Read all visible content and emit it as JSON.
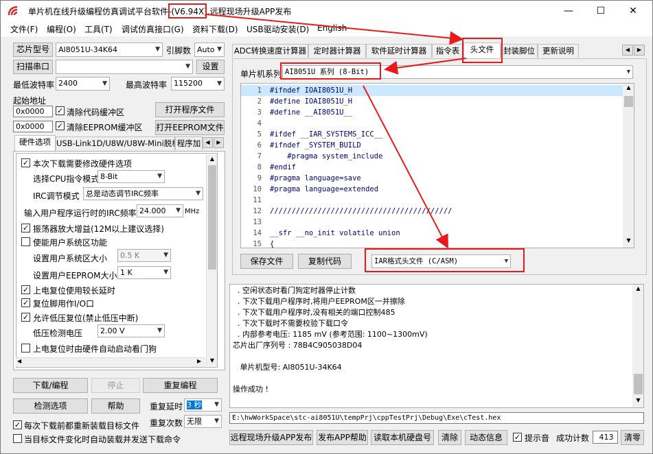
{
  "window": {
    "title_prefix": "单片机在线升级编程仿真调试平台软件-",
    "version": "(V6.94X),",
    "title_suffix": "远程现场升级APP发布",
    "minimize": "—",
    "maximize": "☐",
    "close": "✕"
  },
  "menu": [
    "文件(F)",
    "编程(O)",
    "工具(T)",
    "调试仿真接口(G)",
    "资料下载(D)",
    "USB驱动安装(D)",
    "English"
  ],
  "left": {
    "chip_label": "芯片型号",
    "chip_value": "AI8051U-34K64",
    "pin_label": "引脚数",
    "pin_value": "Auto",
    "scan_button": "扫描串口",
    "port_value": "",
    "settings_button": "设置",
    "min_baud_label": "最低波特率",
    "min_baud_value": "2400",
    "max_baud_label": "最高波特率",
    "max_baud_value": "115200",
    "start_addr_label": "起始地址",
    "addr1": "0x0000",
    "clear_code_label": "清除代码缓冲区",
    "open_program_button": "打开程序文件",
    "addr2": "0x0000",
    "clear_eeprom_label": "清除EEPROM缓冲区",
    "open_eeprom_button": "打开EEPROM文件",
    "tabs": [
      "硬件选项",
      "USB-Link1D/U8W/U8W-Mini脱机",
      "程序加"
    ],
    "hw": {
      "opt_redownload": "本次下载需要修改硬件选项",
      "cpu_mode_label": "选择CPU指令模式",
      "cpu_mode_value": "8-Bit",
      "irc_mode_label": "IRC调节模式",
      "irc_mode_value": "总是动态调节IRC频率",
      "irc_freq_label": "输入用户程序运行时的IRC频率",
      "irc_freq_value": "24.000",
      "irc_freq_unit": "MHz",
      "osc_gain": "振荡器放大增益(12M以上建议选择)",
      "user_sys": "使能用户系统区功能",
      "sys_size_label": "设置用户系统区大小",
      "sys_size_value": "0.5 K",
      "eeprom_size_label": "设置用户EEPROM大小",
      "eeprom_size_value": "1   K",
      "long_reset": "上电复位使用较长延时",
      "reset_io": "复位脚用作I/O口",
      "low_volt_reset": "允许低压复位(禁止低压中断)",
      "low_volt_label": "低压检测电压",
      "low_volt_value": "2.00 V",
      "watchdog": "上电复位时由硬件自动启动看门狗"
    },
    "download_button": "下载/编程",
    "stop_button": "停止",
    "repeat_button": "重复编程",
    "detect_button": "检测选项",
    "help_button": "帮助",
    "repeat_delay_label": "重复延时",
    "repeat_delay_value": "3 秒",
    "repeat_count_label": "重复次数",
    "repeat_count_value": "无限",
    "reload_label": "每次下载前都重新装载目标文件",
    "auto_send_label": "当目标文件变化时自动装载并发送下载命令"
  },
  "right": {
    "tabs": [
      "ADC转换速度计算器",
      "定时器计算器",
      "软件延时计算器",
      "指令表",
      "头文件",
      "封装脚位",
      "更新说明"
    ],
    "series_label": "单片机系列",
    "series_value": "AI8051U 系列 (8-Bit)",
    "code_lines": [
      {
        "n": "1",
        "t": "#ifndef IOAI8051U_H"
      },
      {
        "n": "2",
        "t": "#define IOAI8051U_H"
      },
      {
        "n": "3",
        "t": "#define __AI8051U__"
      },
      {
        "n": "4",
        "t": ""
      },
      {
        "n": "5",
        "t": "#ifdef __IAR_SYSTEMS_ICC__"
      },
      {
        "n": "6",
        "t": "#ifndef _SYSTEM_BUILD"
      },
      {
        "n": "7",
        "t": "    #pragma system_include"
      },
      {
        "n": "8",
        "t": "#endif"
      },
      {
        "n": "9",
        "t": "#pragma language=save"
      },
      {
        "n": "10",
        "t": "#pragma language=extended"
      },
      {
        "n": "11",
        "t": ""
      },
      {
        "n": "12",
        "t": "//////////////////////////////////////////"
      },
      {
        "n": "13",
        "t": ""
      },
      {
        "n": "14",
        "t": "__sfr __no_init volatile union"
      },
      {
        "n": "15",
        "t": "{"
      }
    ],
    "save_button": "保存文件",
    "copy_button": "复制代码",
    "format_value": "IAR格式头文件 (C/ASM)",
    "log": [
      "  . 空闲状态时看门狗定时器停止计数",
      "  . 下次下载用户程序时,将用户EEPROM区一并擦除",
      "  . 下次下载用户程序时,没有相关的端口控制485",
      "  . 下次下载时不需要校验下载口令",
      "  . 内部参考电压: 1185 mV (参考范围: 1100~1300mV)",
      "芯片出厂序列号 : 78B4C905038D04",
      "",
      "   单片机型号: AI8051U-34K64",
      "",
      "操作成功 !"
    ],
    "path": "E:\\hwWorkSpace\\stc-ai8051U\\tempPrj\\cppTestPrj\\Debug\\Exe\\cTest.hex",
    "publish_button": "远程现场升级APP发布",
    "publish_help_button": "发布APP帮助",
    "read_disk_button": "读取本机硬盘号",
    "clear_button": "清除",
    "anim_button": "动态信息",
    "beep_label": "提示音",
    "success_label": "成功计数",
    "success_value": "413",
    "clear2_button": "清零"
  },
  "colors": {
    "annotation": "#e8191a",
    "highlight_line": "#cce8ff",
    "code_text": "#000080",
    "line_no": "#555555"
  }
}
